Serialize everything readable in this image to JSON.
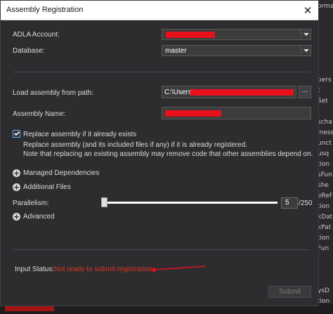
{
  "window": {
    "title": "Assembly Registration"
  },
  "form": {
    "adla_account_label": "ADLA Account:",
    "database_label": "Database:",
    "database_value": "master",
    "load_path_label": "Load assembly from path:",
    "load_path_value": "C:\\Users\\",
    "browse_label": "...",
    "assembly_name_label": "Assembly Name:",
    "replace_label": "Replace assembly if it already exists",
    "replace_checked": true,
    "replace_note_1": "Replace assembly (and its included files if any) if it is already registered.",
    "replace_note_2": "Note that replacing an existing assembly may remove code that other assemblies depend on.",
    "managed_dependencies_label": "Managed Dependencies",
    "additional_files_label": "Additional Files",
    "parallelism_label": "Parallelism:",
    "parallelism_value": "5",
    "parallelism_max": "/250",
    "advanced_label": "Advanced",
    "input_status_label": "Input Status:",
    "input_status_value": "Not ready to submit registration",
    "submit_label": "Submit"
  },
  "colors": {
    "accent": "#6aa6ff",
    "status_error": "#e0321c",
    "redaction": "#e8111b"
  },
  "background": {
    "right_lines": [
      "ormat",
      "",
      "",
      "",
      "",
      "",
      "",
      "pers",
      "t",
      "Set",
      "",
      "scha",
      "iness",
      "unct",
      "usq",
      "tion",
      "sFun",
      "she",
      "eRef",
      "tion",
      "kDat",
      "kPat",
      "tion",
      "Fun",
      "",
      "",
      "",
      "ysD",
      "tion"
    ]
  }
}
